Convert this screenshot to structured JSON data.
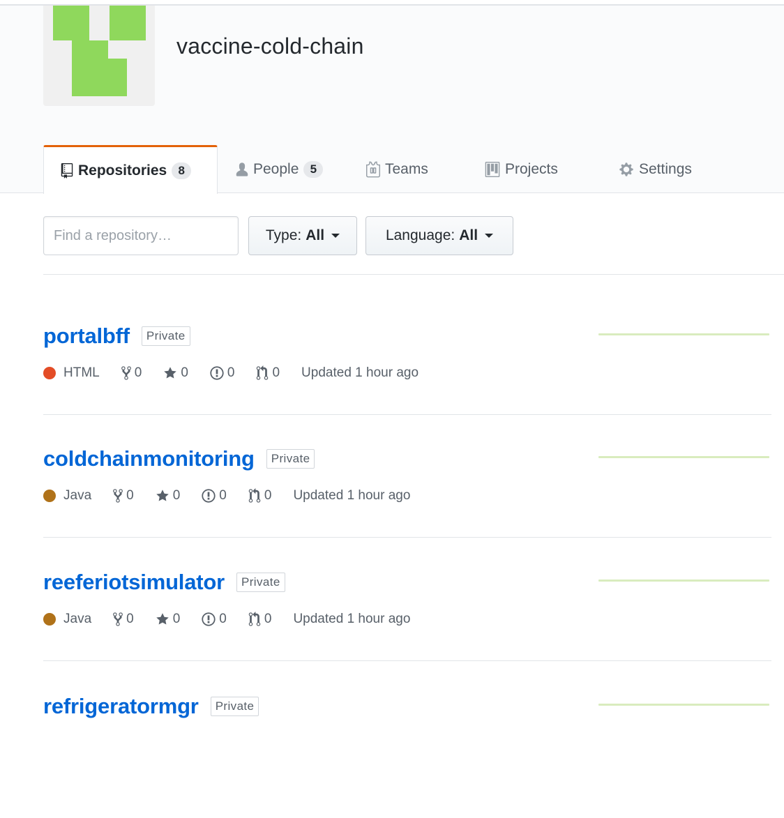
{
  "org": {
    "name": "vaccine-cold-chain"
  },
  "tabs": [
    {
      "label": "Repositories",
      "count": "8",
      "icon": "repo-icon"
    },
    {
      "label": "People",
      "count": "5",
      "icon": "person-icon"
    },
    {
      "label": "Teams",
      "icon": "jersey-icon"
    },
    {
      "label": "Projects",
      "icon": "project-icon"
    },
    {
      "label": "Settings",
      "icon": "gear-icon"
    }
  ],
  "filters": {
    "search_placeholder": "Find a repository…",
    "type_label": "Type:",
    "type_value": "All",
    "language_label": "Language:",
    "language_value": "All"
  },
  "repos": [
    {
      "name": "portalbff",
      "visibility": "Private",
      "language": "HTML",
      "language_color": "#e34c26",
      "forks": "0",
      "stars": "0",
      "issues": "0",
      "prs": "0",
      "updated": "Updated 1 hour ago"
    },
    {
      "name": "coldchainmonitoring",
      "visibility": "Private",
      "language": "Java",
      "language_color": "#b07219",
      "forks": "0",
      "stars": "0",
      "issues": "0",
      "prs": "0",
      "updated": "Updated 1 hour ago"
    },
    {
      "name": "reeferiotsimulator",
      "visibility": "Private",
      "language": "Java",
      "language_color": "#b07219",
      "forks": "0",
      "stars": "0",
      "issues": "0",
      "prs": "0",
      "updated": "Updated 1 hour ago"
    },
    {
      "name": "refrigeratormgr",
      "visibility": "Private"
    }
  ],
  "colors": {
    "accent_tab": "#e36209",
    "link": "#0366d6",
    "avatar_green": "#8fd85c",
    "sparkline": "#d9ecbe"
  }
}
